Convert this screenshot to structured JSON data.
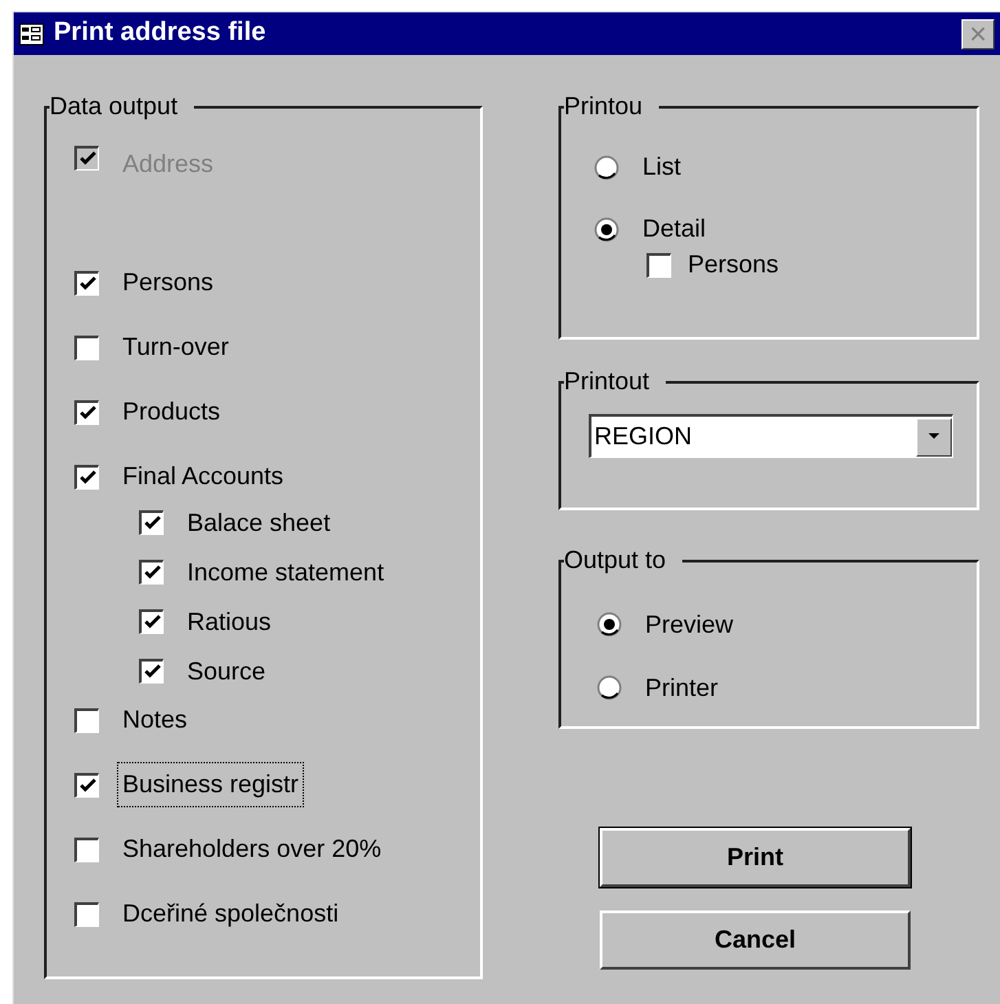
{
  "window": {
    "title": "Print address file",
    "close_label": "×"
  },
  "data_output": {
    "title": "Data output",
    "items": [
      {
        "label": "Address",
        "checked": true,
        "disabled": true,
        "focused": false
      },
      {
        "label": "Persons",
        "checked": true,
        "disabled": false,
        "focused": false
      },
      {
        "label": "Turn-over",
        "checked": false,
        "disabled": false,
        "focused": false
      },
      {
        "label": "Products",
        "checked": true,
        "disabled": false,
        "focused": false
      },
      {
        "label": "Final Accounts",
        "checked": true,
        "disabled": false,
        "focused": false,
        "children": [
          {
            "label": "Balace sheet",
            "checked": true
          },
          {
            "label": "Income statement",
            "checked": true
          },
          {
            "label": "Ratious",
            "checked": true
          },
          {
            "label": "Source",
            "checked": true
          }
        ]
      },
      {
        "label": "Notes",
        "checked": false,
        "disabled": false,
        "focused": false
      },
      {
        "label": "Business registr",
        "checked": true,
        "disabled": false,
        "focused": true
      },
      {
        "label": "Shareholders over 20%",
        "checked": false,
        "disabled": false,
        "focused": false
      },
      {
        "label": "Dceřiné společnosti",
        "checked": false,
        "disabled": false,
        "focused": false
      }
    ]
  },
  "printout_type": {
    "title": "Printou",
    "options": [
      {
        "label": "List",
        "selected": false
      },
      {
        "label": "Detail",
        "selected": true
      }
    ],
    "persons": {
      "label": "Persons",
      "checked": false
    }
  },
  "printout_group": {
    "title": "Printout",
    "value": "REGION"
  },
  "output_to": {
    "title": "Output to",
    "options": [
      {
        "label": "Preview",
        "selected": true
      },
      {
        "label": "Printer",
        "selected": false
      }
    ]
  },
  "buttons": [
    {
      "label": "Print",
      "default": true
    },
    {
      "label": "Cancel",
      "default": false
    }
  ]
}
